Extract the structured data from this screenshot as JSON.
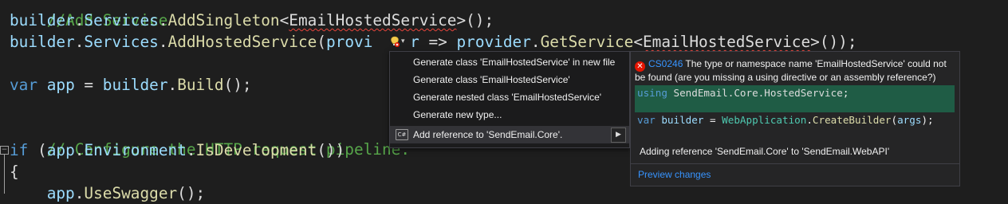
{
  "editor": {
    "line0": {
      "comment": "//Add Service"
    },
    "line1": {
      "obj": "builder",
      "dot1": ".",
      "prop": "Services",
      "dot2": ".",
      "method": "AddSingleton",
      "lt": "<",
      "type": "EmailHostedService",
      "rest": ">();"
    },
    "line2": {
      "obj": "builder",
      "dot1": ".",
      "prop": "Services",
      "dot2": ".",
      "method": "AddHostedService",
      "paren": "(",
      "param_a": "provi",
      "gap": "    ",
      "param_b": "r",
      "arrow": " => ",
      "param2": "provider",
      "dot3": ".",
      "method2": "GetService",
      "lt": "<",
      "type": "EmailHostedService",
      "rest": ">());"
    },
    "line3": {
      "keyword": "var",
      "sp": " ",
      "var": "app",
      "eq": " = ",
      "obj": "builder",
      "dot": ".",
      "method": "Build",
      "rest": "();"
    },
    "line4": {
      "comment": "// Configure the HTTP request pipeline."
    },
    "line5": {
      "keyword": "if",
      "open": " (",
      "obj": "app",
      "dot1": ".",
      "prop": "Environment",
      "dot2": ".",
      "method": "IsDevelopment",
      "rest": "())"
    },
    "line6": {
      "brace": "{"
    },
    "line7": {
      "indent": "    ",
      "obj": "app",
      "dot": ".",
      "method": "UseSwagger",
      "rest": "();"
    },
    "fold_glyph": "−"
  },
  "lightbulb": {
    "icon": "lightbulb-error-icon",
    "chevron": "▾"
  },
  "menu": {
    "items": [
      {
        "label": "Generate class 'EmailHostedService' in new file"
      },
      {
        "label": "Generate class 'EmailHostedService'"
      },
      {
        "label": "Generate nested class 'EmailHostedService'"
      },
      {
        "label": "Generate new type..."
      },
      {
        "label": "Add reference to 'SendEmail.Core'.",
        "icon": "C#",
        "submenu_arrow": "▶",
        "selected": true
      }
    ]
  },
  "preview": {
    "error_icon_glyph": "✕",
    "error_code": "CS0246",
    "error_message": "The type or namespace name 'EmailHostedService' could not be found (are you missing a using directive or an assembly reference?)",
    "line1": {
      "keyword": "using",
      "ns": " SendEmail.Core.HostedService",
      "semi": ";"
    },
    "line2": {
      "keyword": "var",
      "var": " builder",
      "eq": " = ",
      "type": "WebApplication",
      "dot": ".",
      "method": "CreateBuilder",
      "open": "(",
      "arg": "args",
      "close": ");"
    },
    "note": "Adding reference 'SendEmail.Core' to 'SendEmail.WebAPI'",
    "link": "Preview changes"
  },
  "colors": {
    "background": "#1e1e1e",
    "comment": "#57a64a",
    "keyword": "#569cd6",
    "method": "#dcdcaa",
    "identifier": "#9cdcfe",
    "error": "#e51400",
    "link": "#3794ff",
    "diff_added": "#1f5c45"
  }
}
